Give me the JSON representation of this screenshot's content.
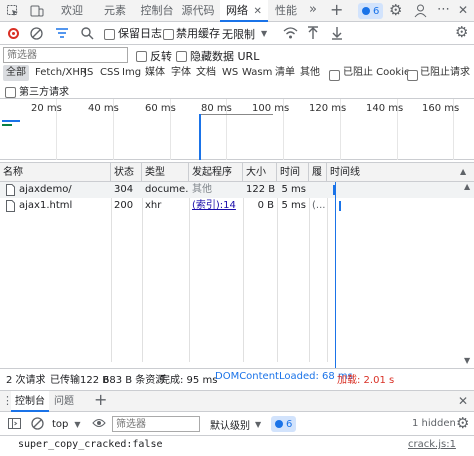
{
  "tabs": [
    {
      "label": "欢迎"
    },
    {
      "label": "元素"
    },
    {
      "label": "控制台"
    },
    {
      "label": "源代码"
    },
    {
      "label": "网络"
    },
    {
      "label": "性能"
    }
  ],
  "issues_badge": "6",
  "toolbar": {
    "preserve_log": "保留日志",
    "disable_cache": "禁用缓存",
    "throttle": "无限制"
  },
  "filter": {
    "placeholder": "筛选器",
    "invert": "反转",
    "hide_data_urls": "隐藏数据 URL"
  },
  "type_filters": [
    "全部",
    "Fetch/XHR",
    "JS",
    "CSS",
    "Img",
    "媒体",
    "字体",
    "文档",
    "WS",
    "Wasm",
    "清单",
    "其他"
  ],
  "blocked_cookies": "已阻止 Cookie",
  "blocked_requests": "已阻止请求",
  "third_party": "第三方请求",
  "overview_ticks": [
    "20 ms",
    "40 ms",
    "60 ms",
    "80 ms",
    "100 ms",
    "120 ms",
    "140 ms",
    "160 ms"
  ],
  "columns": {
    "name": "名称",
    "status": "状态",
    "type": "类型",
    "initiator": "发起程序",
    "size": "大小",
    "time": "时间",
    "fulfilled": "履",
    "waterfall": "时间线"
  },
  "rows": [
    {
      "name": "ajaxdemo/",
      "status": "304",
      "type": "docume...",
      "initiator": "其他",
      "size": "122 B",
      "time": "5 ms",
      "fulfilled": ""
    },
    {
      "name": "ajax1.html",
      "status": "200",
      "type": "xhr",
      "initiator": "(索引):14",
      "size": "0 B",
      "time": "5 ms",
      "fulfilled": "(..."
    }
  ],
  "status": {
    "requests": "2 次请求",
    "transferred": "已传输122 B",
    "resources": "683 B 条资源",
    "finish": "完成: 95 ms",
    "dcl": "DOMContentLoaded: 68 ms",
    "load": "加载: 2.01 s"
  },
  "drawer_tabs": [
    "控制台",
    "问题"
  ],
  "console": {
    "context": "top",
    "filter_placeholder": "筛选器",
    "levels": "默认级别",
    "badge": "6",
    "hidden": "1 hidden",
    "log_text": "super_copy_cracked:false",
    "log_source": "crack.js:1"
  },
  "colors": {
    "accent": "#1a73e8",
    "record_red": "#d93025",
    "dcl_blue": "#1a73e8",
    "load_red": "#d93025"
  }
}
